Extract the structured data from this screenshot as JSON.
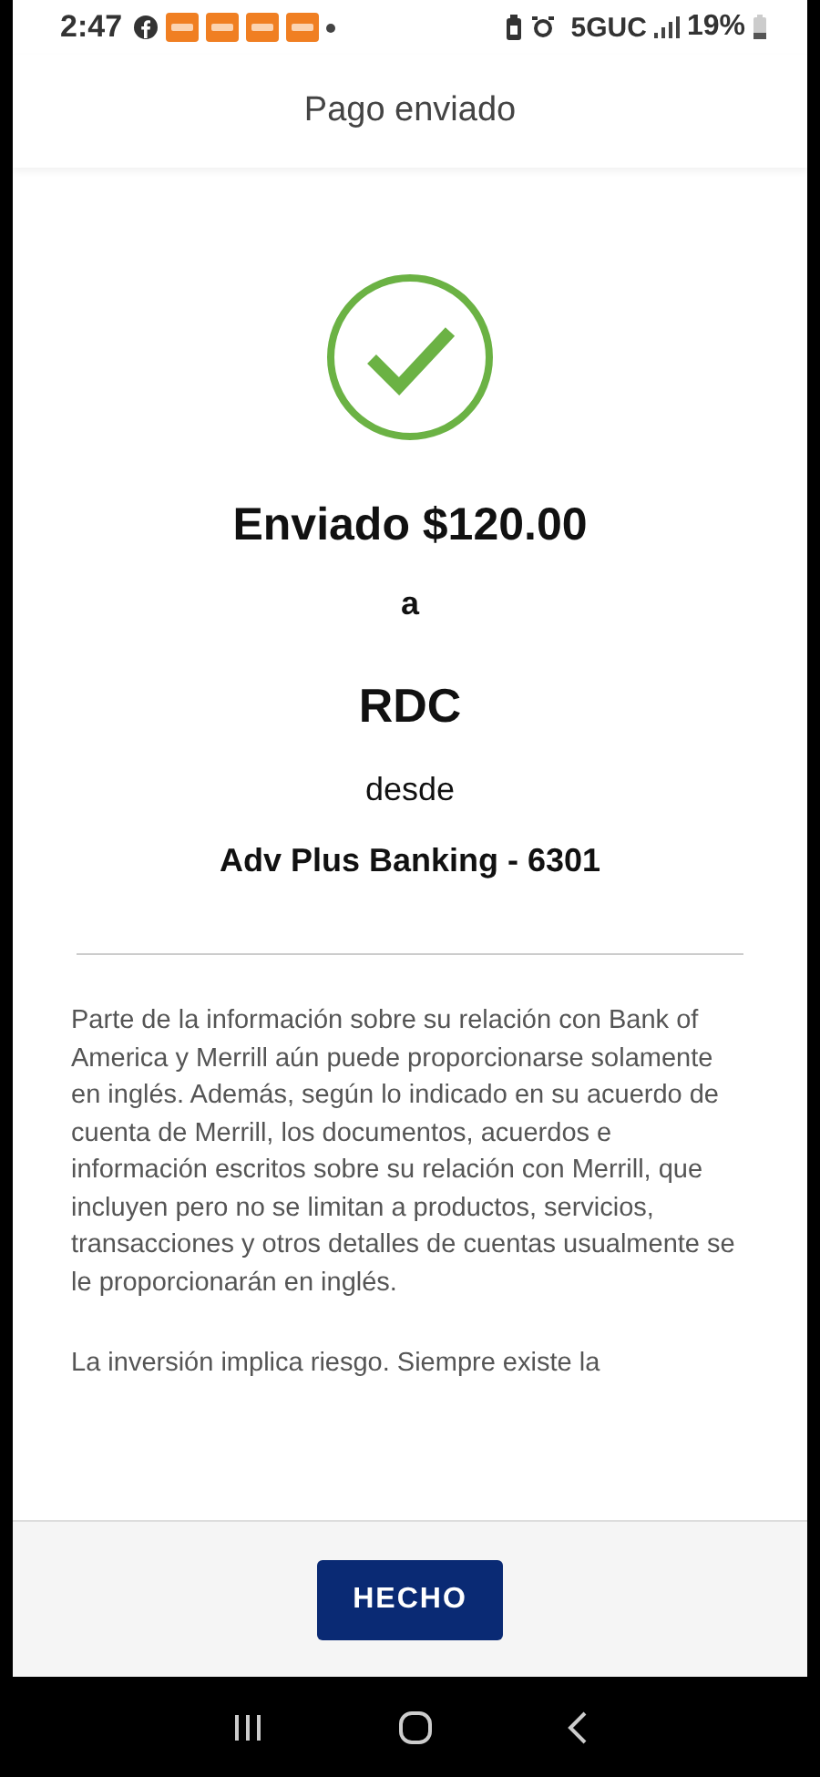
{
  "status_bar": {
    "time": "2:47",
    "network": "5GUC",
    "battery": "19%"
  },
  "header": {
    "title": "Pago enviado"
  },
  "confirmation": {
    "amount_line": "Enviado $120.00",
    "to_word": "a",
    "recipient": "RDC",
    "from_word": "desde",
    "account": "Adv Plus Banking - 6301"
  },
  "disclosures": [
    "Parte de la información sobre su relación con Bank of America y Merrill aún puede proporcionarse solamente en inglés. Además, según lo indicado en su acuerdo de cuenta de Merrill, los documentos, acuerdos e información escritos sobre su relación con Merrill, que incluyen pero no se limitan a productos, servicios, transacciones y otros detalles de cuentas usualmente se le proporcionarán en inglés.",
    "La inversión implica riesgo. Siempre existe la"
  ],
  "footer": {
    "button": "HECHO"
  }
}
